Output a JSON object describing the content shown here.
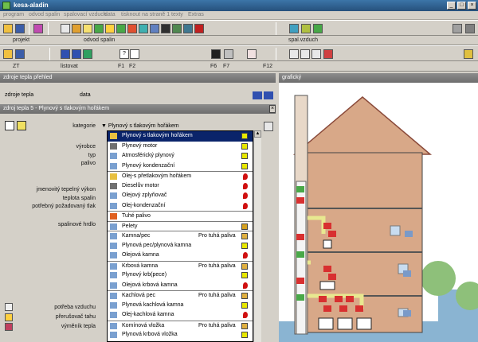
{
  "window": {
    "title": "kesa-aladin",
    "btn_min": "_",
    "btn_max": "□",
    "btn_close": "×"
  },
  "menu": [
    "program",
    "odvod spalin",
    "spalovací vzduch",
    "data",
    "tisknout na straně 1",
    "texty",
    "Extras"
  ],
  "toolbar2": {
    "label_projekt": "projekt",
    "label_odvod": "odvod spalin",
    "label_spal": "spal.vzduch"
  },
  "toolbar3": {
    "label_zt": "ZT",
    "label_listovat": "listovat",
    "f1": "F1",
    "f2": "F2",
    "f6": "F6",
    "f7": "F7",
    "f12": "F12",
    "q": "?"
  },
  "sections": {
    "zdroje_prehled": "zdroje tepla přehled",
    "tab_zdroje": "zdroje tepla",
    "tab_data": "data",
    "panel_title": "zdroj tepla 5 - Plynový s tlakovým hořákem",
    "graficky": "grafický"
  },
  "fields": {
    "kategorie": "kategorie",
    "kategorie_value": "Plynový s tlakovým hořákem",
    "vyrobce": "výrobce",
    "typ": "typ",
    "palivo": "palivo",
    "jmenovity": "jmenovitý tepelný výkon",
    "teplota": "teplota spalin",
    "tlak": "potřebný požadovaný tlak",
    "hrdlo": "spalinové hrdlo",
    "potreba": "potřeba vzduchu",
    "prerusovac": "přerušovač tahu",
    "vymenik": "výměník tepla"
  },
  "dropdown": [
    {
      "label": "Plynový s tlakovým hořákem",
      "extra": "",
      "icon": "flame-icon",
      "mark": "gas",
      "selected": true,
      "sep": false
    },
    {
      "label": "Plynový motor",
      "extra": "",
      "icon": "motor-icon",
      "mark": "gas",
      "selected": false,
      "sep": false
    },
    {
      "label": "Atmosférický plynový",
      "extra": "",
      "icon": "burner-icon",
      "mark": "gas",
      "selected": false,
      "sep": false
    },
    {
      "label": "Plynový kondenzační",
      "extra": "",
      "icon": "burner-icon",
      "mark": "gas",
      "selected": false,
      "sep": false
    },
    {
      "label": "Olej-s přetlakovým hořákem",
      "extra": "",
      "icon": "flame-icon",
      "mark": "oil",
      "selected": false,
      "sep": true
    },
    {
      "label": "Dieselův motor",
      "extra": "",
      "icon": "motor-icon",
      "mark": "oil",
      "selected": false,
      "sep": false
    },
    {
      "label": "Olejový zplyňovač",
      "extra": "",
      "icon": "burner-icon",
      "mark": "oil",
      "selected": false,
      "sep": false
    },
    {
      "label": "Olej-kondenzační",
      "extra": "",
      "icon": "burner-icon",
      "mark": "oil",
      "selected": false,
      "sep": false
    },
    {
      "label": "Tuhé palivo",
      "extra": "",
      "icon": "fire-icon",
      "mark": "",
      "selected": false,
      "sep": true
    },
    {
      "label": "Pelety",
      "extra": "",
      "icon": "pellet-icon",
      "mark": "pellet",
      "selected": false,
      "sep": true
    },
    {
      "label": "Kamna/pec",
      "extra": "Pro tuhá paliva",
      "icon": "stove-icon",
      "mark": "solid",
      "selected": false,
      "sep": true
    },
    {
      "label": "Plynová pec/plynová kamna",
      "extra": "",
      "icon": "stove-icon",
      "mark": "gas",
      "selected": false,
      "sep": false
    },
    {
      "label": "Olejová kamna",
      "extra": "",
      "icon": "stove-icon",
      "mark": "oil",
      "selected": false,
      "sep": false
    },
    {
      "label": "Krbová kamna",
      "extra": "Pro tuhá paliva",
      "icon": "stove-icon",
      "mark": "solid",
      "selected": false,
      "sep": true
    },
    {
      "label": "Plynový krb(pece)",
      "extra": "",
      "icon": "stove-icon",
      "mark": "gas",
      "selected": false,
      "sep": false
    },
    {
      "label": "Olejová krbová kamna",
      "extra": "",
      "icon": "stove-icon",
      "mark": "oil",
      "selected": false,
      "sep": false
    },
    {
      "label": "Kachlová pec",
      "extra": "Pro tuhá paliva",
      "icon": "stove-icon",
      "mark": "solid",
      "selected": false,
      "sep": true
    },
    {
      "label": "Plynová kachlová kamna",
      "extra": "",
      "icon": "stove-icon",
      "mark": "gas",
      "selected": false,
      "sep": false
    },
    {
      "label": "Olej-kachlová kamna",
      "extra": "",
      "icon": "stove-icon",
      "mark": "oil",
      "selected": false,
      "sep": false
    },
    {
      "label": "Komínová vložka",
      "extra": "Pro tuhá paliva",
      "icon": "stove-icon",
      "mark": "solid",
      "selected": false,
      "sep": true
    },
    {
      "label": "Plynová krbová vložka",
      "extra": "",
      "icon": "stove-icon",
      "mark": "gas",
      "selected": false,
      "sep": false
    }
  ],
  "graphic": {
    "labels": [
      {
        "text": "1",
        "type": "red"
      },
      {
        "text": "2",
        "type": "red"
      },
      {
        "text": "3",
        "type": "red"
      },
      {
        "text": "4",
        "type": "red"
      },
      {
        "text": "5",
        "type": "red"
      },
      {
        "text": "6",
        "type": "red"
      },
      {
        "text": "7",
        "type": "red"
      },
      {
        "text": "8",
        "type": "red"
      },
      {
        "text": "1",
        "type": "blue"
      },
      {
        "text": "2",
        "type": "blue"
      },
      {
        "text": "3",
        "type": "blue"
      },
      {
        "text": "1",
        "type": "green"
      },
      {
        "text": "2",
        "type": "green"
      },
      {
        "text": "3",
        "type": "green"
      },
      {
        "text": "4",
        "type": "green"
      }
    ]
  },
  "colors": {
    "selection": "#0a246a",
    "gas": "#e8e800",
    "oil": "#d01010",
    "wall": "#d8a888",
    "sky": "#8ab4d2",
    "title": "#26507c"
  }
}
